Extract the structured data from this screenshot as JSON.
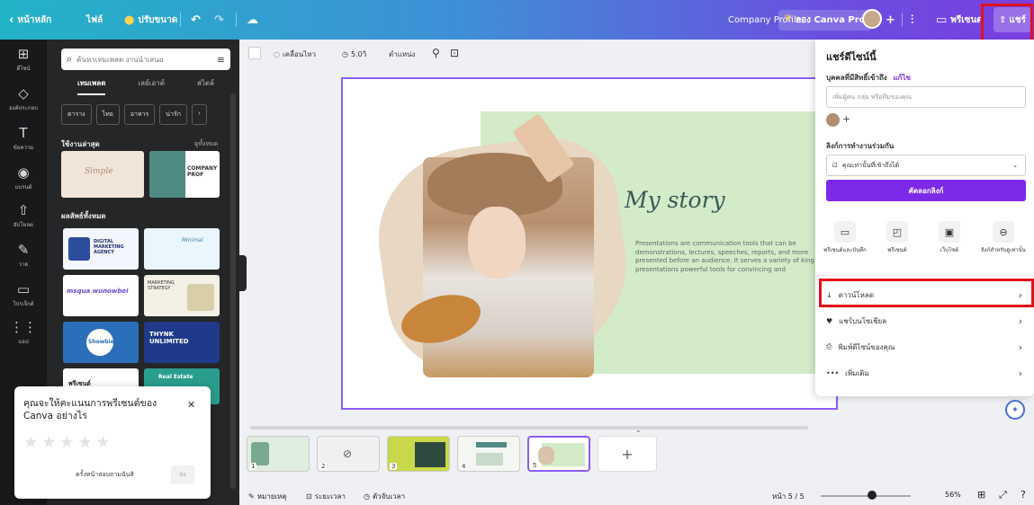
{
  "topbar": {
    "home": "หน้าหลัก",
    "file": "ไฟล์",
    "resize": "ปรับขนาด",
    "doc_title": "Company Profile",
    "try_pro": "ลอง Canva Pro",
    "present": "พรีเซนต",
    "share": "แชร์"
  },
  "rail": [
    {
      "label": "ดีไซน์",
      "icon": "⊞"
    },
    {
      "label": "องค์ประกอบ",
      "icon": "◇"
    },
    {
      "label": "ข้อความ",
      "icon": "T"
    },
    {
      "label": "แบรนด์",
      "icon": "◉"
    },
    {
      "label": "อัปโหลด",
      "icon": "⇧"
    },
    {
      "label": "วาด",
      "icon": "✎"
    },
    {
      "label": "โปรเจ็กต์",
      "icon": "▭"
    },
    {
      "label": "แอป",
      "icon": "⋮⋮"
    }
  ],
  "panel": {
    "search_placeholder": "ค้นหาเทมเพลต งานนำเสนอ",
    "tabs": [
      "เทมเพลต",
      "เลย์เอาต์",
      "สไตล์"
    ],
    "chips": [
      "ตาราง",
      "ไทย",
      "อาหาร",
      "น่ารัก"
    ],
    "recent_title": "ใช้งานล่าสุด",
    "see_all": "ดูทั้งหมด",
    "results_title": "ผลลัพธ์ทั้งหมด",
    "thumb_texts": [
      "DIGITAL MARKETING AGENCY",
      "Minimal",
      "MARKETING STRATEGY",
      "msqua wunowbei",
      "THYNK UNLIMITED",
      "Showbie",
      "Real Estate",
      "พรีเซนต์",
      "COMPANY PROF"
    ]
  },
  "canvas": {
    "toolbar": {
      "animate": "เคลื่อนไหว",
      "duration": "5.0วิ",
      "position": "ตำแหน่ง"
    },
    "slide_title": "My story",
    "slide_body": "Presentations are communication tools that can be demonstrations, lectures, speeches, reports, and more presented before an audience. It serves a variety of king presentations powerful tools for convincing and",
    "pages": [
      "1",
      "2",
      "3",
      "4",
      "5"
    ],
    "add_page": "+"
  },
  "bottombar": {
    "notes": "หมายเหตุ",
    "duration": "ระยะเวลา",
    "timer": "ตัวจับเวลา",
    "page": "หน้า 5 / 5",
    "zoom": "56%"
  },
  "share": {
    "title": "แชร์ดีไซน์นี้",
    "people_label": "บุคคลที่มีสิทธิ์เข้าถึง",
    "edit": "แก้ไข",
    "input_placeholder": "เพิ่มผู้คน กลุ่ม หรือทีมของคุณ",
    "collab_label": "ลิงก์การทำงานร่วมกัน",
    "access": "คุณเท่านั้นที่เข้าถึงได้",
    "copy_link": "คัดลอกลิงก์",
    "options": [
      {
        "label": "พรีเซนต์และบันทึก",
        "icon": "▭"
      },
      {
        "label": "พรีเซนต์",
        "icon": "◰"
      },
      {
        "label": "เว็บไซต์",
        "icon": "▣"
      },
      {
        "label": "ลิงก์สำหรับดูเท่านั้น",
        "icon": "⊖"
      }
    ],
    "rows": [
      {
        "label": "ดาวน์โหลด",
        "icon": "↓"
      },
      {
        "label": "แชร์บนโซเชียล",
        "icon": "♥"
      },
      {
        "label": "พิมพ์ดีไซน์ของคุณ",
        "icon": "⎙"
      },
      {
        "label": "เพิ่มเติม",
        "icon": "•••"
      }
    ]
  },
  "rating": {
    "question": "คุณจะให้คะแนนการพรีเซนต์ของ Canva อย่างไร",
    "later": "ครั้งหน้าสอบถามฉันสิ",
    "send": "ส่ง"
  },
  "colors": {
    "accent": "#7d2ae8",
    "highlight": "#e3101a",
    "slide_green": "#d3ebc9"
  }
}
